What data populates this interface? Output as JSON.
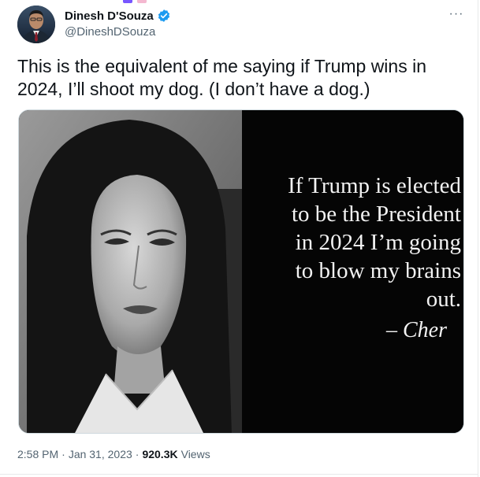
{
  "author": {
    "name": "Dinesh D'Souza",
    "handle": "@DineshDSouza",
    "verified": true,
    "verified_color": "#1d9bf0",
    "avatar_icon": "profile-photo"
  },
  "more_icon": "ellipsis-icon",
  "more_label": "···",
  "tweet": {
    "text": "This is the equivalent of me saying if Trump wins in 2024, I’ll shoot my dog. (I don’t have a dog.)"
  },
  "media": {
    "quote_text": "If Trump is elected\nto be the President\nin 2024 I’m going\nto blow my brains\nout.",
    "quote_attribution": "– Cher"
  },
  "meta": {
    "time": "2:58 PM",
    "date": "Jan 31, 2023",
    "separator": "·",
    "views_count": "920.3K",
    "views_label": "Views"
  },
  "colors": {
    "text": "#0f1419",
    "secondary": "#536471",
    "border": "#e7e9ea"
  }
}
